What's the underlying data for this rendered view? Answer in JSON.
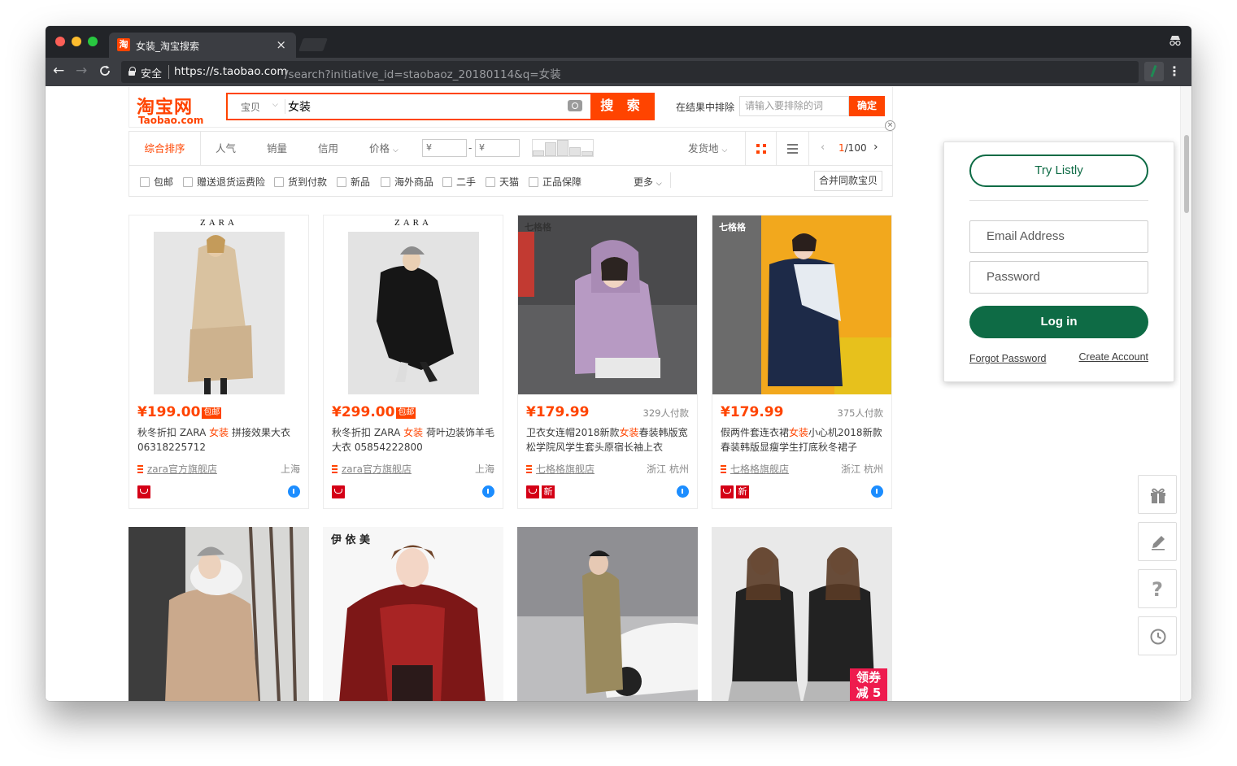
{
  "browser": {
    "tab_title": "女装_淘宝搜索",
    "favicon": "淘",
    "tab_close": "×",
    "secure_label": "安全",
    "url_host": "https://s.taobao.com",
    "url_path": "/search?initiative_id=staobaoz_20180114&q=女装",
    "icons": [
      "back-icon",
      "forward-icon",
      "reload-icon",
      "lock-icon",
      "listly-extension-icon",
      "menu-dots-icon",
      "incognito-icon"
    ]
  },
  "header": {
    "logo_cn": "淘宝网",
    "logo_en": "Taobao.com",
    "search_type": "宝贝",
    "search_query": "女装",
    "search_button": "搜 索",
    "exclude_label": "在结果中排除",
    "exclude_placeholder": "请输入要排除的词",
    "exclude_button": "确定",
    "close": "×"
  },
  "sortbar": {
    "items": [
      "综合排序",
      "人气",
      "销量",
      "信用",
      "价格"
    ],
    "price_from": "¥",
    "price_to": "¥",
    "price_dash": "-",
    "ship_from": "发货地",
    "page_current": "1",
    "page_total": "/100",
    "prev": "‹",
    "next": "›"
  },
  "filters": {
    "options": [
      "包邮",
      "赠送退货运费险",
      "货到付款",
      "新品",
      "海外商品",
      "二手",
      "天猫",
      "正品保障"
    ],
    "more": "更多",
    "merge": "合并同款宝贝"
  },
  "products": [
    {
      "brand_mark": "ZARA",
      "price": "¥199.00",
      "badge": "包邮",
      "paid": "",
      "title_pre": "秋冬折扣 ZARA ",
      "title_hl": "女装",
      "title_post": " 拼接效果大衣 06318225712",
      "shop": "zara官方旗舰店",
      "location": "上海",
      "new": ""
    },
    {
      "brand_mark": "ZARA",
      "price": "¥299.00",
      "badge": "包邮",
      "paid": "",
      "title_pre": "秋冬折扣 ZARA ",
      "title_hl": "女装",
      "title_post": " 荷叶边装饰羊毛大衣 05854222800",
      "shop": "zara官方旗舰店",
      "location": "上海",
      "new": ""
    },
    {
      "brand_mark": "七格格",
      "price": "¥179.99",
      "badge": "",
      "paid": "329人付款",
      "title_pre": "卫衣女连帽2018新款",
      "title_hl": "女装",
      "title_post": "春装韩版宽松学院风学生套头原宿长袖上衣",
      "shop": "七格格旗舰店",
      "location": "浙江 杭州",
      "new": "新"
    },
    {
      "brand_mark": "七格格",
      "price": "¥179.99",
      "badge": "",
      "paid": "375人付款",
      "title_pre": "假两件套连衣裙",
      "title_hl": "女装",
      "title_post": "小心机2018新款春装韩版显瘦学生打底秋冬裙子",
      "shop": "七格格旗舰店",
      "location": "浙江 杭州",
      "new": "新"
    }
  ],
  "row2": {
    "coupon_line1": "领券",
    "coupon_line2": "减 5",
    "mark2": "伊 依 美"
  },
  "listly": {
    "try_button": "Try Listly",
    "email_placeholder": "Email Address",
    "password_placeholder": "Password",
    "login_button": "Log in",
    "forgot": "Forgot Password",
    "create": "Create Account"
  },
  "side_widgets": [
    "gift-icon",
    "pencil-icon",
    "help-icon",
    "history-icon"
  ],
  "side_help": "?",
  "colors": {
    "taobao_orange": "#ff4400",
    "listly_green": "#0e6b45",
    "chrome_dark": "#3b3d42"
  }
}
